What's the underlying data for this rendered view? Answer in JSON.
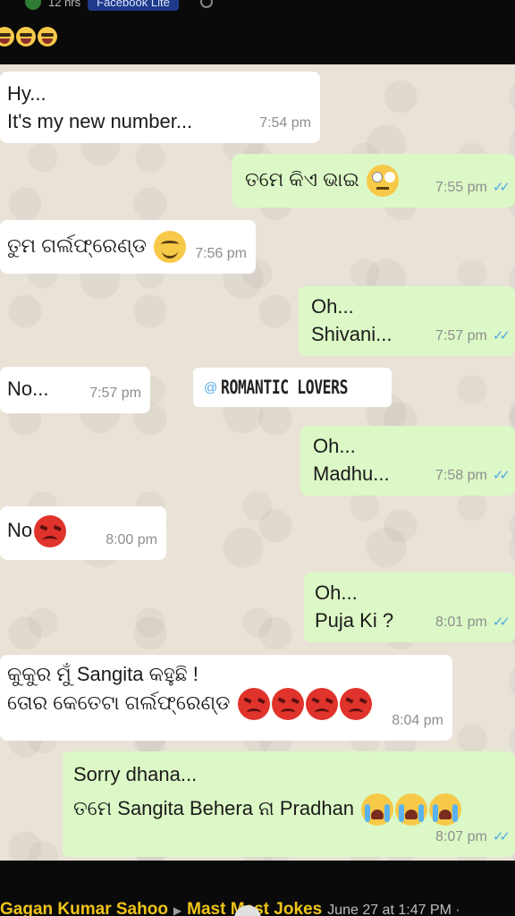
{
  "top": {
    "status_text": "12 hrs",
    "app_label": "Facebook Lite"
  },
  "messages": [
    {
      "dir": "in",
      "lines": [
        "Hy...",
        "It's my new number..."
      ],
      "time": "7:54 pm"
    },
    {
      "dir": "out",
      "lines": [
        "ତମେ କିଏ ଭାଇ"
      ],
      "time": "7:55 pm"
    },
    {
      "dir": "in",
      "lines": [
        "ତୁମ ଗର୍ଲଫ୍ରେଣ୍ଡ"
      ],
      "time": "7:56 pm"
    },
    {
      "dir": "out",
      "lines": [
        "Oh...",
        "Shivani..."
      ],
      "time": "7:57 pm"
    },
    {
      "dir": "in",
      "lines": [
        "No..."
      ],
      "time": "7:57 pm"
    },
    {
      "dir": "out",
      "lines": [
        "Oh...",
        "Madhu..."
      ],
      "time": "7:58 pm"
    },
    {
      "dir": "in",
      "lines": [
        "No"
      ],
      "time": "8:00 pm"
    },
    {
      "dir": "out",
      "lines": [
        "Oh...",
        "Puja Ki ?"
      ],
      "time": "8:01 pm"
    },
    {
      "dir": "in",
      "lines": [
        "କୁକୁର ମୁଁ Sangita କହୁଛି !",
        "ତୋର କେତେଟା ଗର୍ଲଫ୍ରେଣ୍ଡ"
      ],
      "time": "8:04 pm"
    },
    {
      "dir": "out",
      "lines": [
        "Sorry dhana...",
        "ତମେ Sangita Behera ନା Pradhan"
      ],
      "time": "8:07 pm"
    }
  ],
  "read_ticks": "✓✓",
  "watermark": {
    "at": "@",
    "text": "ROMANTIC LOVERS"
  },
  "footer": {
    "author": "Gagan Kumar Sahoo",
    "arrow": "▶",
    "group": "Mast Mast Jokes",
    "date": "June 27 at 1:47 PM ·"
  },
  "icons": {
    "laugh": "laughing-emoji",
    "roll": "eye-roll-emoji",
    "smile": "smiling-emoji",
    "angry": "angry-emoji",
    "cry": "crying-emoji"
  }
}
